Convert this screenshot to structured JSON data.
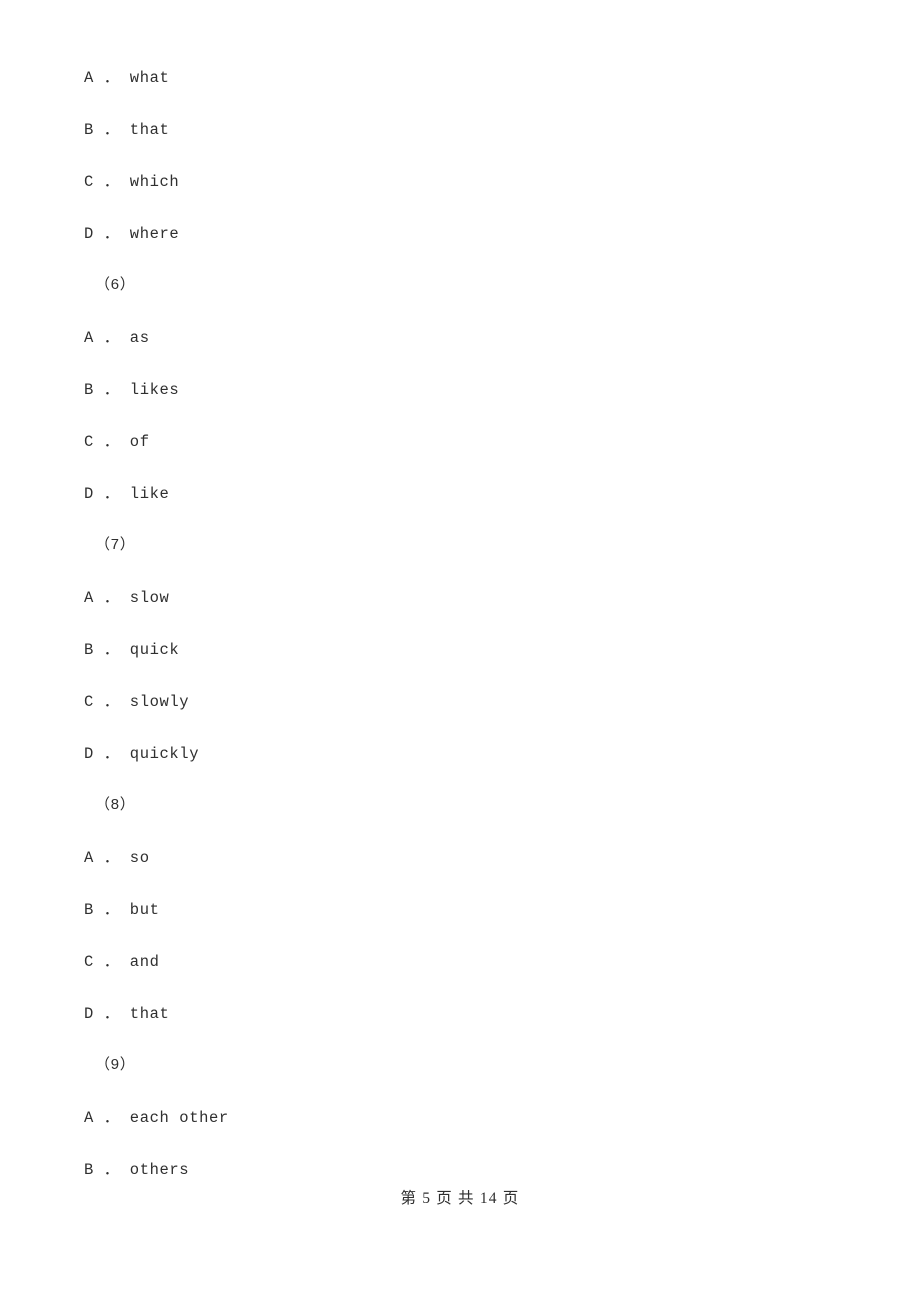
{
  "document": {
    "type": "exam-paper",
    "text_color": "#2f2f2f",
    "background_color": "#ffffff"
  },
  "blocks": [
    {
      "kind": "option",
      "text": "A ． what"
    },
    {
      "kind": "option",
      "text": "B ． that"
    },
    {
      "kind": "option",
      "text": "C ． which"
    },
    {
      "kind": "option",
      "text": "D ． where"
    },
    {
      "kind": "qnum",
      "text": "（6）"
    },
    {
      "kind": "option",
      "text": "A ． as"
    },
    {
      "kind": "option",
      "text": "B ． likes"
    },
    {
      "kind": "option",
      "text": "C ． of"
    },
    {
      "kind": "option",
      "text": "D ． like"
    },
    {
      "kind": "qnum",
      "text": "（7）"
    },
    {
      "kind": "option",
      "text": "A ． slow"
    },
    {
      "kind": "option",
      "text": "B ． quick"
    },
    {
      "kind": "option",
      "text": "C ． slowly"
    },
    {
      "kind": "option",
      "text": "D ． quickly"
    },
    {
      "kind": "qnum",
      "text": "（8）"
    },
    {
      "kind": "option",
      "text": "A ． so"
    },
    {
      "kind": "option",
      "text": "B ． but"
    },
    {
      "kind": "option",
      "text": "C ． and"
    },
    {
      "kind": "option",
      "text": "D ． that"
    },
    {
      "kind": "qnum",
      "text": "（9）"
    },
    {
      "kind": "option",
      "text": "A ． each other"
    },
    {
      "kind": "option",
      "text": "B ． others"
    }
  ],
  "footer": {
    "text": "第 5 页 共 14 页",
    "current_page": "5",
    "total_pages": "14"
  }
}
